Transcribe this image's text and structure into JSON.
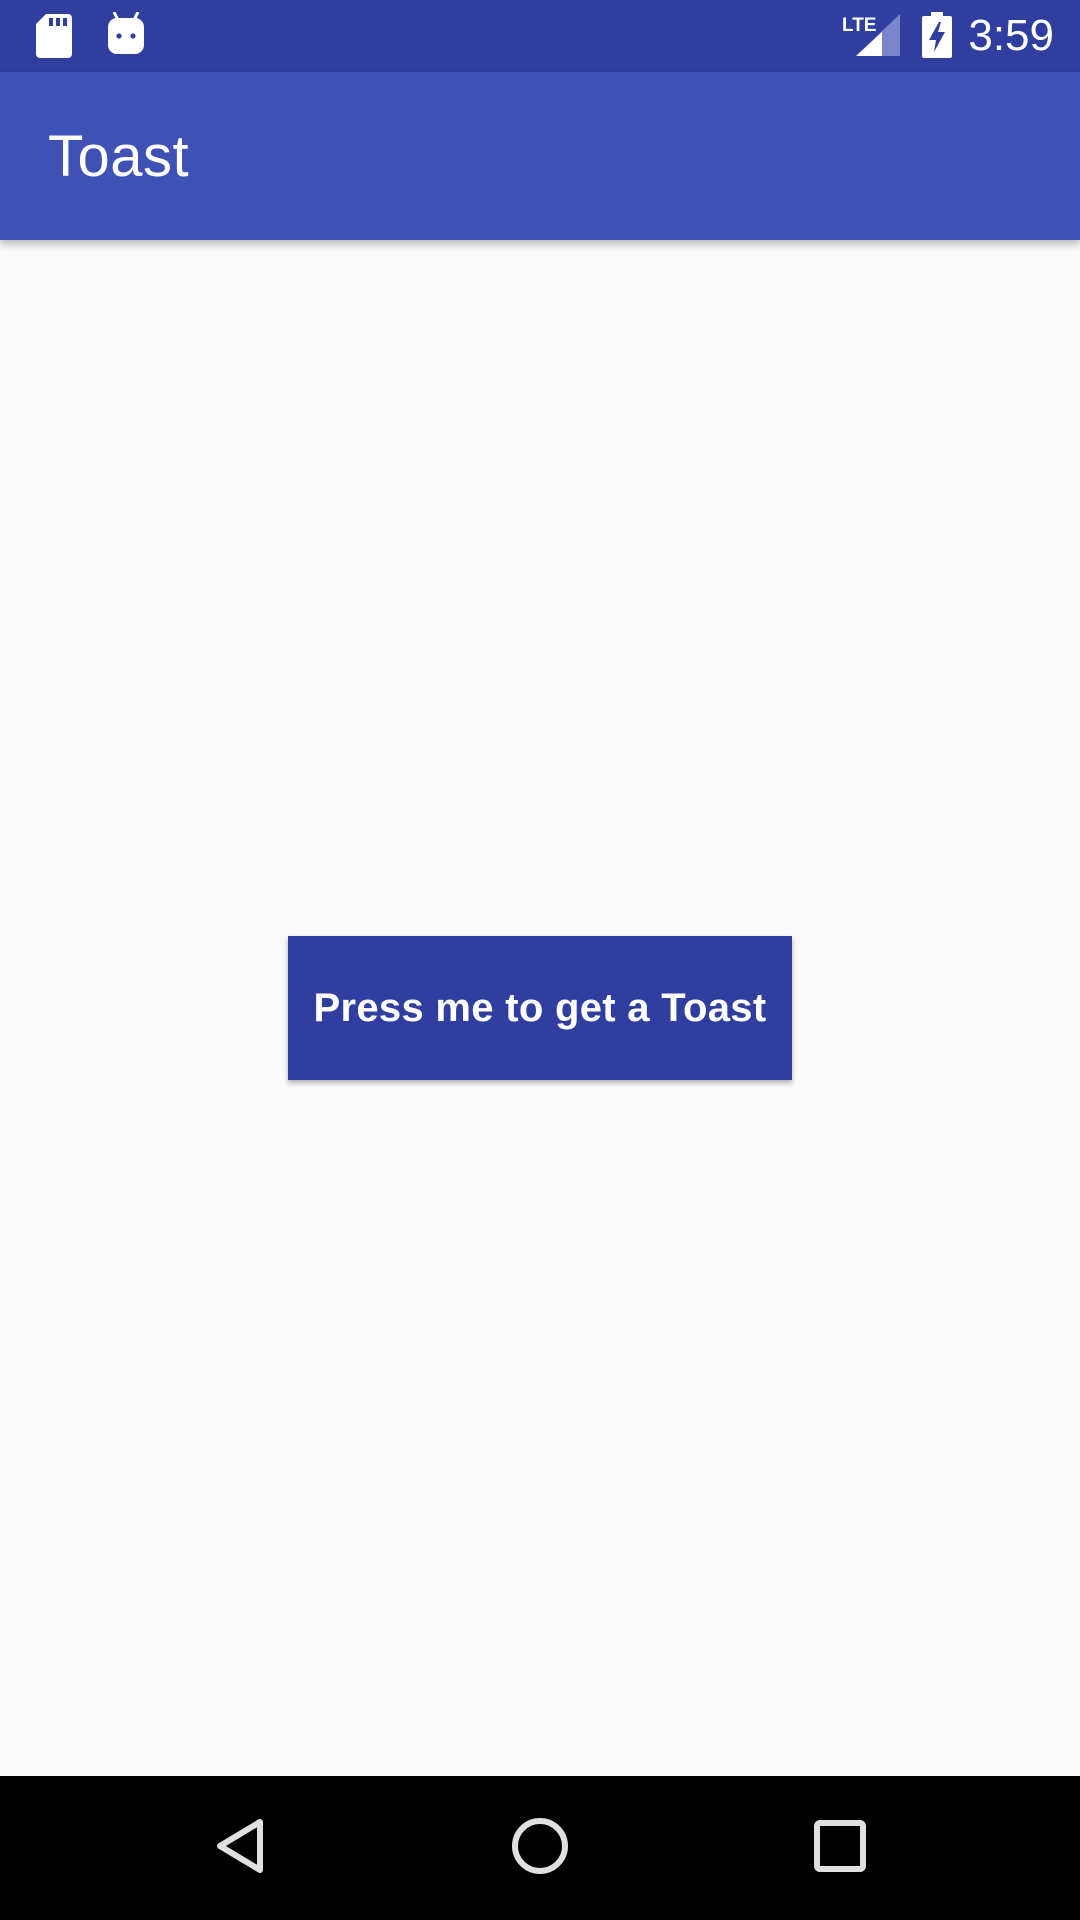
{
  "status_bar": {
    "time": "3:59",
    "network_label": "LTE",
    "icons": [
      "sd-card-icon",
      "android-debug-icon",
      "lte-signal-icon",
      "battery-charging-icon"
    ]
  },
  "app_bar": {
    "title": "Toast"
  },
  "main": {
    "button_label": "Press me to get a Toast"
  },
  "nav_bar": {
    "icons": [
      "back-icon",
      "home-icon",
      "recents-icon"
    ]
  },
  "colors": {
    "status_bar": "#303F9F",
    "app_bar": "#3F51B5",
    "button": "#303F9F",
    "background": "#FAFAFA",
    "nav_bar": "#000000"
  }
}
